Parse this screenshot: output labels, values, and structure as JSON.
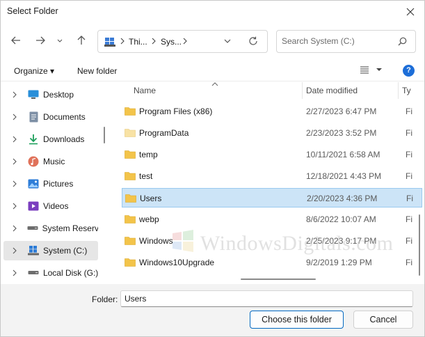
{
  "window": {
    "title": "Select Folder"
  },
  "address": {
    "segments": [
      "Thi...",
      "Sys..."
    ],
    "pc_icon": "this-pc-icon"
  },
  "search": {
    "placeholder": "Search System (C:)"
  },
  "toolbar": {
    "organize_label": "Organize ▾",
    "new_folder_label": "New folder",
    "help_label": "?"
  },
  "nav": {
    "items": [
      {
        "label": "Desktop",
        "icon": "desktop-icon"
      },
      {
        "label": "Documents",
        "icon": "documents-icon"
      },
      {
        "label": "Downloads",
        "icon": "downloads-icon"
      },
      {
        "label": "Music",
        "icon": "music-icon"
      },
      {
        "label": "Pictures",
        "icon": "pictures-icon"
      },
      {
        "label": "Videos",
        "icon": "videos-icon"
      },
      {
        "label": "System Reserve",
        "icon": "drive-icon"
      },
      {
        "label": "System (C:)",
        "icon": "windows-drive-icon",
        "selected": true
      },
      {
        "label": "Local Disk (G:)",
        "icon": "drive-icon"
      }
    ]
  },
  "files": {
    "columns": {
      "name": "Name",
      "date": "Date modified",
      "type": "Ty"
    },
    "rows": [
      {
        "name": "Program Files (x86)",
        "date": "2/27/2023 6:47 PM",
        "type": "Fi"
      },
      {
        "name": "ProgramData",
        "date": "2/23/2023 3:52 PM",
        "type": "Fi",
        "faded": true
      },
      {
        "name": "temp",
        "date": "10/11/2021 6:58 AM",
        "type": "Fi"
      },
      {
        "name": "test",
        "date": "12/18/2021 4:43 PM",
        "type": "Fi"
      },
      {
        "name": "Users",
        "date": "2/20/2023 4:36 PM",
        "type": "Fi",
        "selected": true
      },
      {
        "name": "webp",
        "date": "8/6/2022 10:07 AM",
        "type": "Fi"
      },
      {
        "name": "Windows",
        "date": "2/25/2023 9:17 PM",
        "type": "Fi"
      },
      {
        "name": "Windows10Upgrade",
        "date": "9/2/2019 1:29 PM",
        "type": "Fi"
      }
    ]
  },
  "watermark": {
    "text": "WindowsDigitals.com"
  },
  "footer": {
    "folder_label": "Folder:",
    "folder_value": "Users",
    "choose_label": "Choose this folder",
    "cancel_label": "Cancel"
  },
  "colors": {
    "accent": "#0067c0",
    "selection": "#cce4f7",
    "folder": "#f3c44a"
  }
}
